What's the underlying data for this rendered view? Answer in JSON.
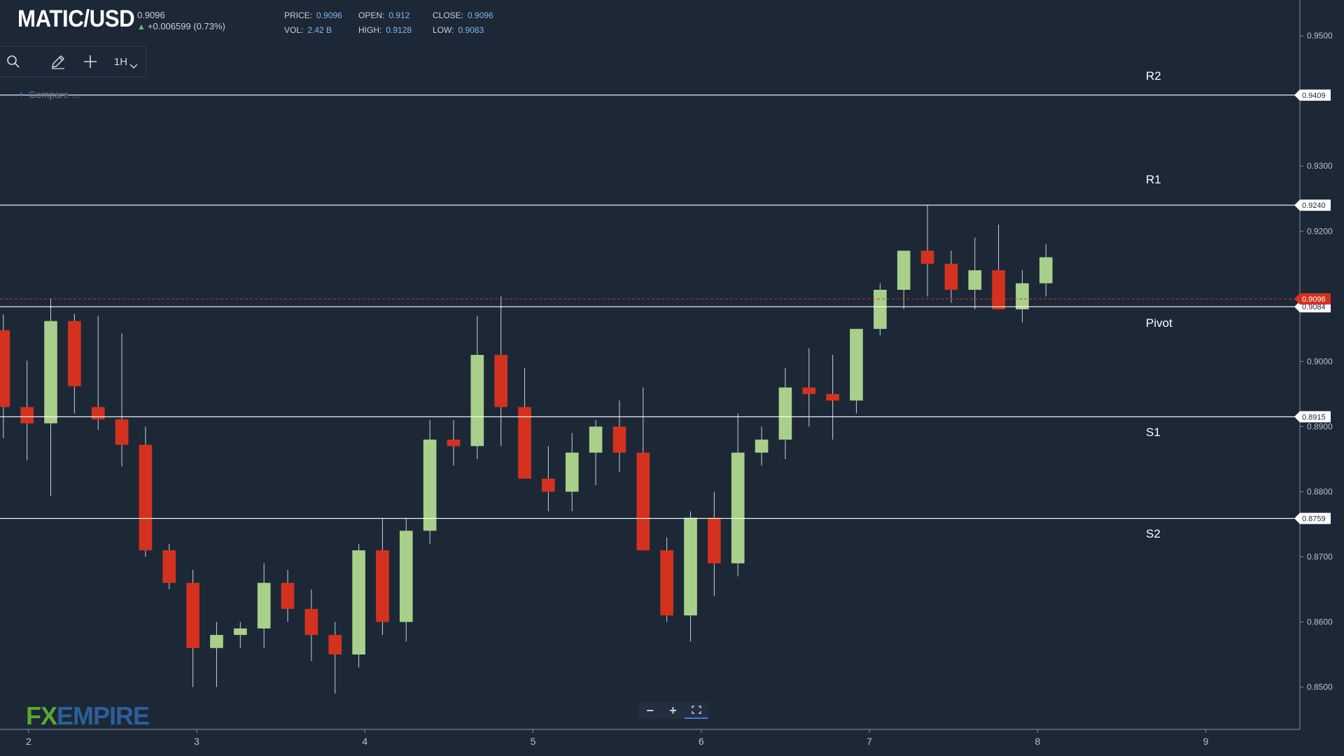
{
  "header": {
    "symbol": "MATIC/USD",
    "price": "0.9096",
    "change": "+0.006599 (0.73%)",
    "stats": [
      {
        "key": "PRICE:",
        "value": "0.9096"
      },
      {
        "key": "OPEN:",
        "value": "0.912"
      },
      {
        "key": "CLOSE:",
        "value": "0.9096"
      },
      {
        "key": "VOL:",
        "value": "2.42 B"
      },
      {
        "key": "HIGH:",
        "value": "0.9128"
      },
      {
        "key": "LOW:",
        "value": "0.9083"
      }
    ]
  },
  "toolbar": {
    "search_icon": "search-icon",
    "draw_icon": "pencil-icon",
    "add_icon": "plus-icon",
    "timeframe": "1H"
  },
  "compare_label": "Compare ...",
  "zoom": {
    "minus": "−",
    "plus": "+",
    "fullscreen_icon": "fullscreen-icon"
  },
  "logo": {
    "fx": "FX",
    "empire": "EMPIRE"
  },
  "colors": {
    "background": "#1d2837",
    "up": "#a8d08a",
    "down": "#d4321e",
    "level_line": "#ffffff",
    "price_line": "#d4321e",
    "accent": "#7ab8f0"
  },
  "chart_data": {
    "type": "candlestick",
    "x_tick_labels": [
      "2",
      "3",
      "4",
      "5",
      "6",
      "7",
      "8",
      "9"
    ],
    "y_tick_labels": [
      "0.9500",
      "0.9300",
      "0.9200",
      "0.9000",
      "0.8900",
      "0.8800",
      "0.8700",
      "0.8600",
      "0.8500"
    ],
    "ylim": [
      0.8435,
      0.9555
    ],
    "xlim": [
      1.83,
      9.56
    ],
    "current_price": {
      "label": "0.9096",
      "value": 0.9096
    },
    "levels": [
      {
        "name": "R2",
        "value": 0.9409,
        "label": "0.9409"
      },
      {
        "name": "R1",
        "value": 0.924,
        "label": "0.9240"
      },
      {
        "name": "Pivot",
        "value": 0.9084,
        "label": "0.9084"
      },
      {
        "name": "S1",
        "value": 0.8915,
        "label": "0.8915"
      },
      {
        "name": "S2",
        "value": 0.8759,
        "label": "0.8759"
      }
    ],
    "candles_ohlc": [
      [
        0.9048,
        0.9072,
        0.8882,
        0.893
      ],
      [
        0.893,
        0.9001,
        0.8848,
        0.8905
      ],
      [
        0.8905,
        0.9097,
        0.8793,
        0.9062
      ],
      [
        0.9062,
        0.9073,
        0.892,
        0.8962
      ],
      [
        0.893,
        0.907,
        0.8895,
        0.8911
      ],
      [
        0.8911,
        0.9043,
        0.8839,
        0.8872
      ],
      [
        0.8872,
        0.89,
        0.87,
        0.871
      ],
      [
        0.871,
        0.872,
        0.865,
        0.866
      ],
      [
        0.866,
        0.868,
        0.85,
        0.856
      ],
      [
        0.856,
        0.86,
        0.85,
        0.858
      ],
      [
        0.858,
        0.86,
        0.856,
        0.859
      ],
      [
        0.859,
        0.869,
        0.856,
        0.866
      ],
      [
        0.866,
        0.868,
        0.86,
        0.862
      ],
      [
        0.862,
        0.865,
        0.854,
        0.858
      ],
      [
        0.858,
        0.86,
        0.849,
        0.855
      ],
      [
        0.855,
        0.872,
        0.853,
        0.871
      ],
      [
        0.871,
        0.876,
        0.858,
        0.86
      ],
      [
        0.86,
        0.876,
        0.857,
        0.874
      ],
      [
        0.874,
        0.891,
        0.872,
        0.888
      ],
      [
        0.888,
        0.891,
        0.884,
        0.887
      ],
      [
        0.887,
        0.907,
        0.885,
        0.901
      ],
      [
        0.901,
        0.91,
        0.887,
        0.893
      ],
      [
        0.893,
        0.899,
        0.883,
        0.882
      ],
      [
        0.882,
        0.887,
        0.877,
        0.88
      ],
      [
        0.88,
        0.889,
        0.877,
        0.886
      ],
      [
        0.886,
        0.891,
        0.881,
        0.89
      ],
      [
        0.89,
        0.894,
        0.883,
        0.886
      ],
      [
        0.886,
        0.896,
        0.873,
        0.871
      ],
      [
        0.871,
        0.873,
        0.86,
        0.861
      ],
      [
        0.861,
        0.877,
        0.857,
        0.876
      ],
      [
        0.876,
        0.88,
        0.864,
        0.869
      ],
      [
        0.869,
        0.892,
        0.867,
        0.886
      ],
      [
        0.886,
        0.89,
        0.884,
        0.888
      ],
      [
        0.888,
        0.899,
        0.885,
        0.896
      ],
      [
        0.896,
        0.902,
        0.89,
        0.895
      ],
      [
        0.895,
        0.901,
        0.888,
        0.894
      ],
      [
        0.894,
        0.905,
        0.892,
        0.905
      ],
      [
        0.905,
        0.912,
        0.904,
        0.911
      ],
      [
        0.911,
        0.916,
        0.908,
        0.917
      ],
      [
        0.917,
        0.924,
        0.91,
        0.915
      ],
      [
        0.915,
        0.917,
        0.909,
        0.911
      ],
      [
        0.911,
        0.919,
        0.908,
        0.914
      ],
      [
        0.914,
        0.921,
        0.908,
        0.908
      ],
      [
        0.908,
        0.914,
        0.906,
        0.912
      ],
      [
        0.912,
        0.918,
        0.91,
        0.916
      ]
    ]
  }
}
